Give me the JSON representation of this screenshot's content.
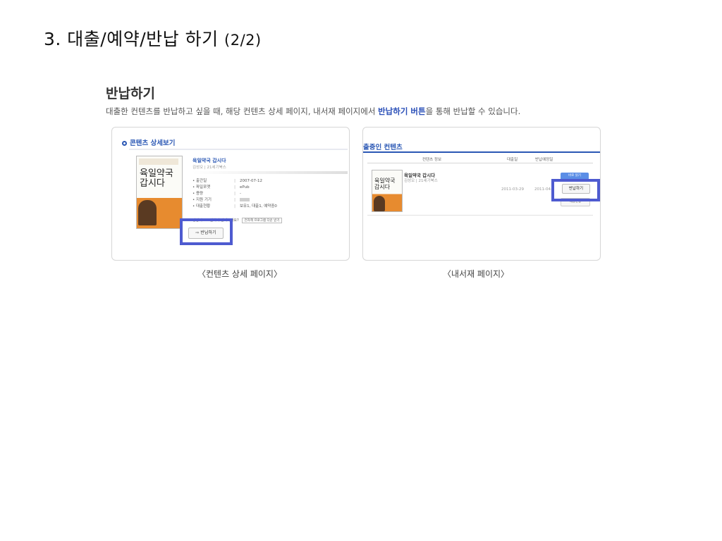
{
  "slide": {
    "title": "3. 대출/예약/반납 하기",
    "title_suffix": "(2/2)"
  },
  "section": {
    "heading": "반납하기",
    "desc_before": "대출한 컨텐츠를 반납하고 싶을 때, 해당 컨텐츠 상세 페이지, 내서재 페이지에서 ",
    "desc_highlight": "반납하기 버튼",
    "desc_after": "을 통해 반납할 수 있습니다."
  },
  "left_panel": {
    "header": "콘텐츠 상세보기",
    "book_title": "육일약국 갑시다",
    "book_sub": "김성오 | 21세기북스",
    "cover_script": "육일약국 갑시다",
    "meta": [
      {
        "key": "출간일",
        "value": "2007-07-12"
      },
      {
        "key": "파일포맷",
        "value": "ePub"
      },
      {
        "key": "용량",
        "value": "-"
      },
      {
        "key": "지원 기기",
        "value": ""
      },
      {
        "key": "대출현황",
        "value": "보유1, 대출1, 예약중0"
      }
    ],
    "device_text": "정상적으로 설치가 안되시나요?",
    "device_button": "전자책 프로그램 다운 받기",
    "return_button": "반납하기",
    "caption": "〈컨텐츠 상세 페이지〉"
  },
  "right_panel": {
    "title": "출중인 컨텐츠",
    "headers": [
      "컨텐츠 정보",
      "대출일",
      "반납예정일"
    ],
    "book_title": "육일약국 갑시다",
    "book_sub": "김성오 | 21세기북스",
    "loan_date": "2011-03-29",
    "due_date": "2011-04-",
    "cover_script": "육일약국 갑시다",
    "button_top": "바로 읽기",
    "return_button": "반납하기",
    "button_bottom": "대출연장",
    "caption": "〈내서재 페이지〉"
  },
  "colors": {
    "accent": "#2a57b4",
    "highlight_box": "#4e5bd0",
    "cover_orange": "#e78b2f"
  }
}
